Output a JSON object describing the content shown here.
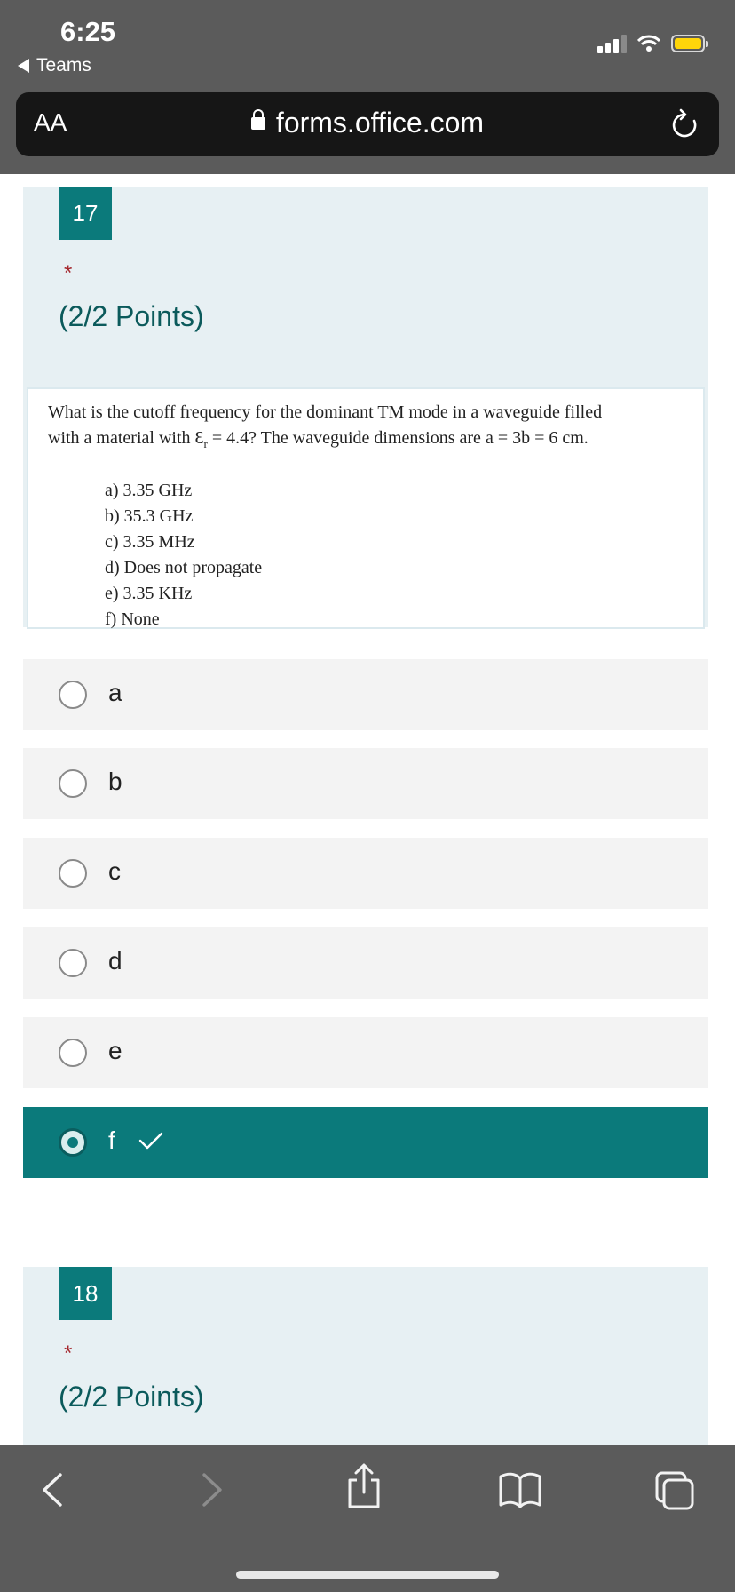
{
  "status_bar": {
    "time": "6:25",
    "back_app": "Teams"
  },
  "browser": {
    "text_size_label": "AA",
    "url": "forms.office.com"
  },
  "question17": {
    "number": "17",
    "required_mark": "*",
    "points": "(2/2 Points)",
    "image_text": {
      "line1": "What is the cutoff frequency for the dominant TM mode in a waveguide filled",
      "line2_pre": "with a material with ",
      "epsilon": "Ɛ",
      "subscript": "r",
      "line2_post": " = 4.4? The waveguide dimensions are a = 3b = 6 cm.",
      "options": [
        "a) 3.35 GHz",
        "b) 35.3 GHz",
        "c) 3.35 MHz",
        "d) Does not propagate",
        "e) 3.35 KHz",
        "f) None"
      ]
    },
    "choices": [
      "a",
      "b",
      "c",
      "d",
      "e",
      "f"
    ],
    "selected_choice": "f"
  },
  "question18": {
    "number": "18",
    "required_mark": "*",
    "points": "(2/2 Points)"
  },
  "toolbar": {
    "icons": [
      "back-icon",
      "forward-icon",
      "share-icon",
      "bookmarks-icon",
      "tabs-icon"
    ]
  },
  "colors": {
    "accent": "#0b7a7b",
    "card_bg": "#e7f0f3",
    "required": "#a4262c"
  }
}
